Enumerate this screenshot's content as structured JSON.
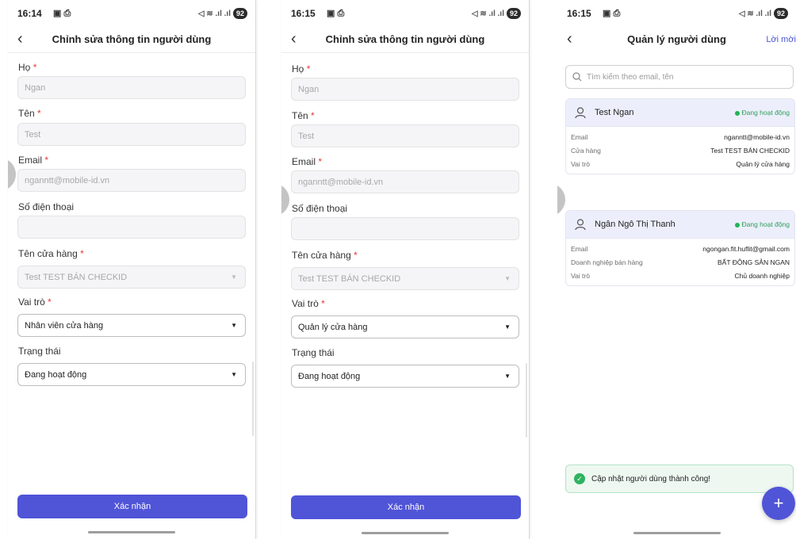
{
  "screen1": {
    "status": {
      "time": "16:14",
      "icons": "▣ ⎙",
      "signal": "◁ ≋ .ıl .ıl",
      "battery": "92"
    },
    "header": {
      "title": "Chỉnh sửa thông tin người dùng"
    },
    "form": {
      "ho_label": "Họ",
      "ho_value": "Ngan",
      "ten_label": "Tên",
      "ten_value": "Test",
      "email_label": "Email",
      "email_value": "nganntt@mobile-id.vn",
      "phone_label": "Số điện thoại",
      "phone_value": "",
      "store_label": "Tên cửa hàng",
      "store_value": "Test TEST BÁN CHECKID",
      "role_label": "Vai trò",
      "role_value": "Nhân viên cửa hàng",
      "status_label": "Trạng thái",
      "status_value": "Đang hoạt động",
      "required_mark": "*"
    },
    "submit_label": "Xác nhận"
  },
  "screen2": {
    "status": {
      "time": "16:15",
      "icons": "▣ ⎙",
      "signal": "◁ ≋ .ıl .ıl",
      "battery": "92"
    },
    "header": {
      "title": "Chỉnh sửa thông tin người dùng"
    },
    "form": {
      "ho_label": "Họ",
      "ho_value": "Ngan",
      "ten_label": "Tên",
      "ten_value": "Test",
      "email_label": "Email",
      "email_value": "nganntt@mobile-id.vn",
      "phone_label": "Số điện thoại",
      "phone_value": "",
      "store_label": "Tên cửa hàng",
      "store_value": "Test TEST BÁN CHECKID",
      "role_label": "Vai trò",
      "role_value": "Quản lý cửa hàng",
      "status_label": "Trạng thái",
      "status_value": "Đang hoạt động",
      "required_mark": "*"
    },
    "submit_label": "Xác nhận"
  },
  "screen3": {
    "status": {
      "time": "16:15",
      "icons": "▣ ⎙",
      "signal": "◁ ≋ .ıl .ıl",
      "battery": "92"
    },
    "header": {
      "title": "Quản lý người dùng",
      "action": "Lời mời"
    },
    "search": {
      "placeholder": "Tìm kiếm theo email, tên"
    },
    "users": [
      {
        "name": "Test Ngan",
        "status": "Đang hoạt động",
        "rows": [
          {
            "label": "Email",
            "value": "nganntt@mobile-id.vn"
          },
          {
            "label": "Cửa hàng",
            "value": "Test TEST BÁN CHECKID"
          },
          {
            "label": "Vai trò",
            "value": "Quản lý cửa hàng"
          }
        ]
      },
      {
        "name": "Ngân Ngô Thị Thanh",
        "status": "Đang hoạt động",
        "rows": [
          {
            "label": "Email",
            "value": "ngongan.fit.huflit@gmail.com"
          },
          {
            "label": "Doanh nghiệp bán hàng",
            "value": "BẤT ĐỘNG SẢN NGAN"
          },
          {
            "label": "Vai trò",
            "value": "Chủ doanh nghiệp"
          }
        ]
      }
    ],
    "toast": "Cập nhật người dùng thành công!",
    "fab_label": "+"
  },
  "colors": {
    "primary": "#5054d7",
    "success": "#2eb360",
    "required": "#e53935"
  }
}
